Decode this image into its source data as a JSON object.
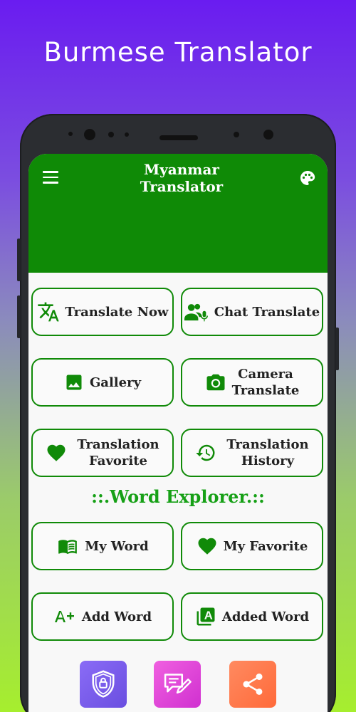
{
  "promo": {
    "title": "Burmese Translator"
  },
  "app": {
    "title_line1": "Myanmar",
    "title_line2": "Translator"
  },
  "buttons": {
    "translate_now": "Translate Now",
    "chat_translate": "Chat Translate",
    "gallery": "Gallery",
    "camera_translate_1": "Camera",
    "camera_translate_2": "Translate",
    "translation_favorite_1": "Translation",
    "translation_favorite_2": "Favorite",
    "translation_history_1": "Translation",
    "translation_history_2": "History",
    "my_word": "My Word",
    "my_favorite": "My Favorite",
    "add_word": "Add Word",
    "added_word": "Added Word"
  },
  "word_explorer": {
    "title": "::.Word Explorer.::"
  },
  "bottom_icons": [
    "privacy-shield-icon",
    "feedback-icon",
    "share-icon"
  ],
  "colors": {
    "primary_green": "#0f8a06",
    "accent_green": "#16a016",
    "privacy_purple": "#7a5cf0",
    "feedback_pink": "#e040d8",
    "share_orange": "#ff7a4a"
  }
}
